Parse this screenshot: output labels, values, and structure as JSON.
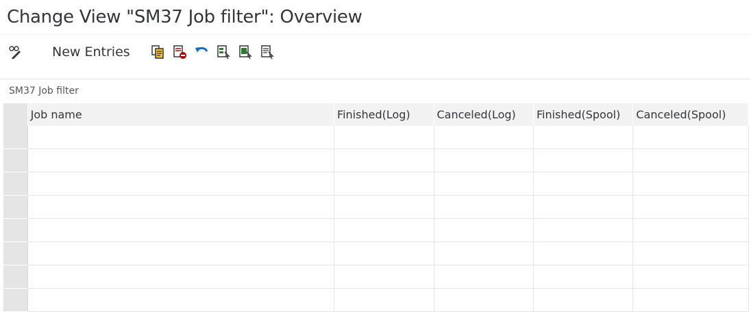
{
  "title": "Change View \"SM37 Job filter\": Overview",
  "toolbar": {
    "display_change_icon": "glasses-pencil-icon",
    "new_entries_label": "New Entries",
    "buttons": [
      {
        "name": "copy-as-button",
        "icon": "copy-icon"
      },
      {
        "name": "delete-button",
        "icon": "delete-icon"
      },
      {
        "name": "undo-button",
        "icon": "undo-icon"
      },
      {
        "name": "select-all-button",
        "icon": "select-all-icon"
      },
      {
        "name": "select-block-button",
        "icon": "select-block-icon"
      },
      {
        "name": "deselect-all-button",
        "icon": "deselect-all-icon"
      }
    ]
  },
  "panel": {
    "title": "SM37 Job filter",
    "columns": [
      "Job name",
      "Finished(Log)",
      "Canceled(Log)",
      "Finished(Spool)",
      "Canceled(Spool)"
    ],
    "rows": [
      [
        "",
        "",
        "",
        "",
        ""
      ],
      [
        "",
        "",
        "",
        "",
        ""
      ],
      [
        "",
        "",
        "",
        "",
        ""
      ],
      [
        "",
        "",
        "",
        "",
        ""
      ],
      [
        "",
        "",
        "",
        "",
        ""
      ],
      [
        "",
        "",
        "",
        "",
        ""
      ],
      [
        "",
        "",
        "",
        "",
        ""
      ],
      [
        "",
        "",
        "",
        "",
        ""
      ]
    ]
  },
  "colors": {
    "header_bg": "#f2f2f2",
    "selector_bg": "#e5e5e5",
    "grid_line": "#e5e5e5",
    "text": "#32363a",
    "icon_green": "#2b7d2b",
    "icon_red": "#bb0000",
    "icon_blue": "#0a6ed1"
  }
}
